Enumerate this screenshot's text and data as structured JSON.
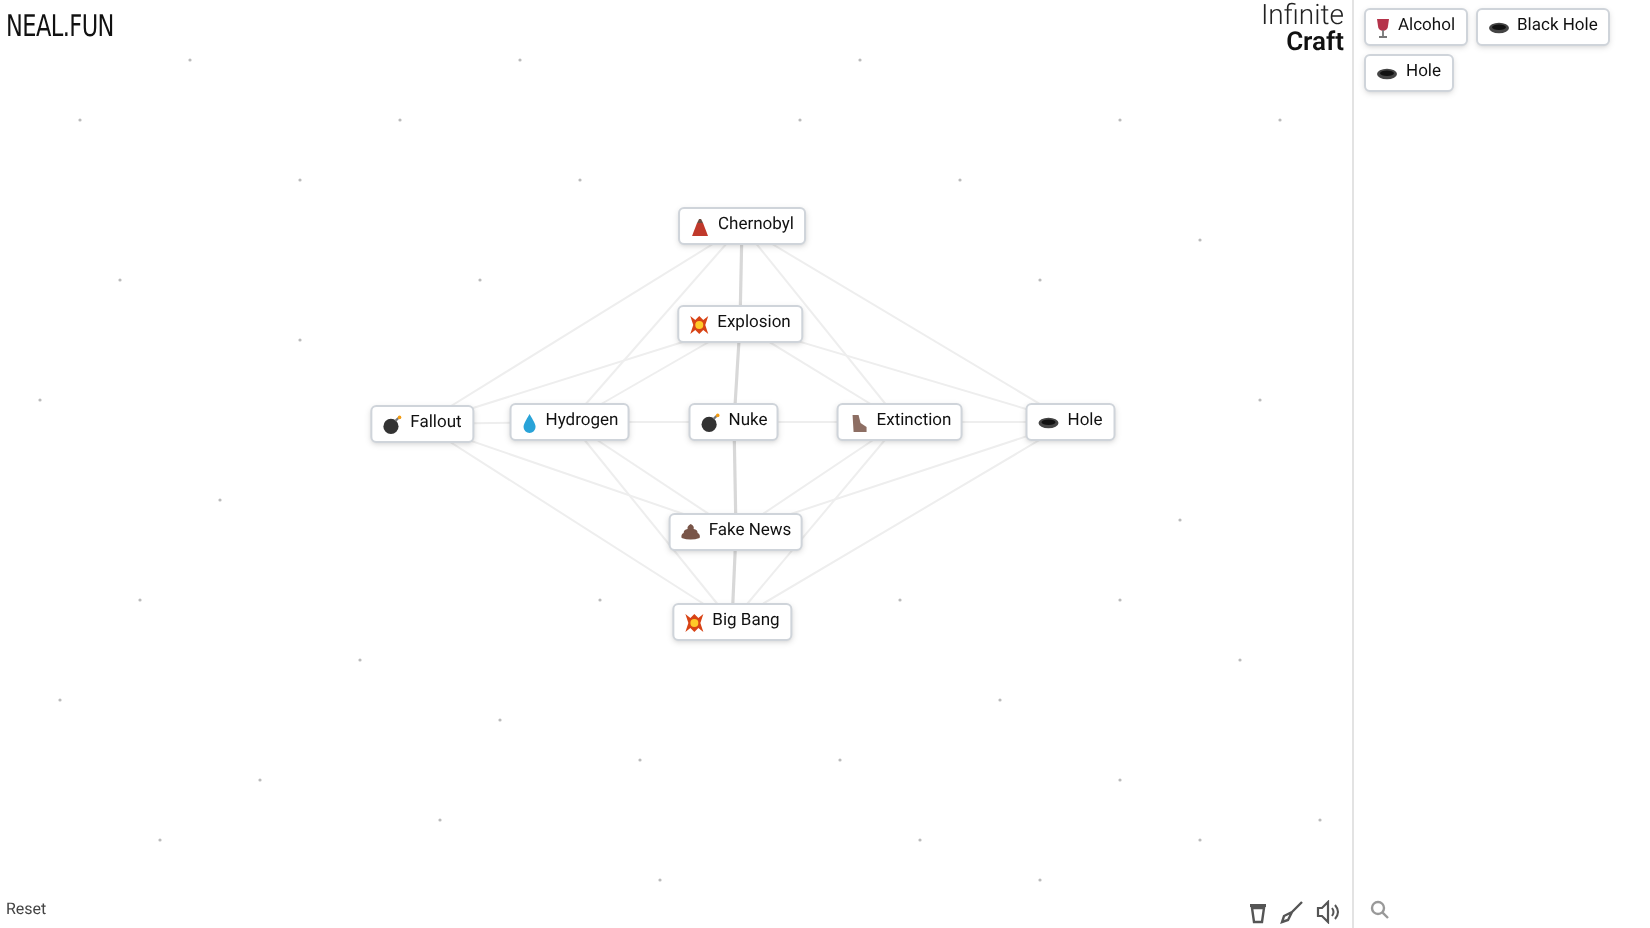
{
  "logo": "NEAL.FUN",
  "title": {
    "line_1": "Infinite",
    "line_2": "Craft"
  },
  "canvas_items": [
    {
      "label": "Chernobyl"
    },
    {
      "label": "Explosion"
    },
    {
      "label": "Fallout"
    },
    {
      "label": "Hydrogen"
    },
    {
      "label": "Nuke"
    },
    {
      "label": "Extinction"
    },
    {
      "label": "Hole"
    },
    {
      "label": "Fake News"
    },
    {
      "label": "Big Bang"
    }
  ],
  "sidebar": {
    "items": [
      {
        "label": "Alcohol"
      },
      {
        "label": "Black Hole"
      },
      {
        "label": "Hole"
      }
    ]
  },
  "reset": "Reset"
}
